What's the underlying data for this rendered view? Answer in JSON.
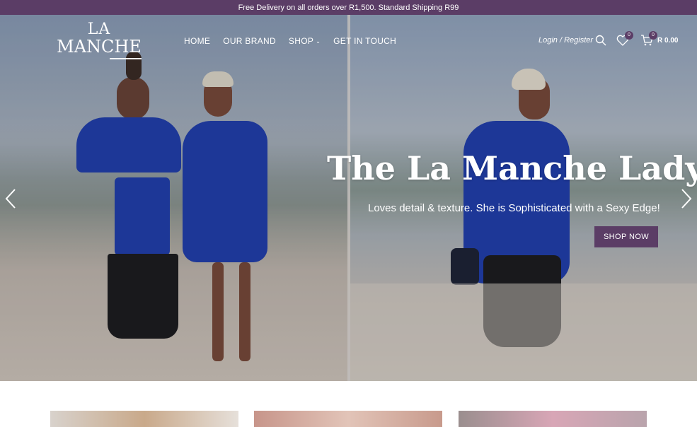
{
  "topbar": {
    "text": "Free Delivery on all orders over R1,500. Standard Shipping R99"
  },
  "logo": {
    "line1": "LA",
    "line2": "MANCHE"
  },
  "nav": {
    "items": [
      {
        "label": "HOME"
      },
      {
        "label": "OUR BRAND"
      },
      {
        "label": "SHOP"
      },
      {
        "label": "GET IN TOUCH"
      }
    ]
  },
  "header": {
    "login_label": "Login / Register",
    "wishlist_count": "0",
    "cart_count": "0",
    "cart_total": "R 0.00"
  },
  "hero": {
    "title": "The La Manche Lady",
    "subtitle": "Loves detail & texture. She is Sophisticated with a Sexy Edge!",
    "cta": "SHOP NOW"
  },
  "colors": {
    "brand": "#5b3d66",
    "dress": "#1f3fb0"
  },
  "icons": [
    "search-icon",
    "heart-icon",
    "cart-icon",
    "arrow-left-icon",
    "arrow-right-icon",
    "chevron-down-icon"
  ]
}
